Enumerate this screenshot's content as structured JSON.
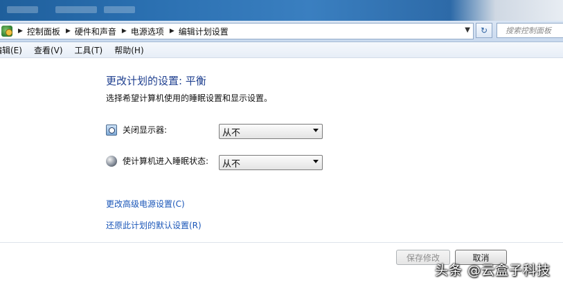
{
  "breadcrumb": [
    "控制面板",
    "硬件和声音",
    "电源选项",
    "编辑计划设置"
  ],
  "search": {
    "placeholder": "搜索控制面板"
  },
  "menu": [
    "编辑(E)",
    "查看(V)",
    "工具(T)",
    "帮助(H)"
  ],
  "page": {
    "title": "更改计划的设置: 平衡",
    "subtitle": "选择希望计算机使用的睡眠设置和显示设置。"
  },
  "settings": [
    {
      "label": "关闭显示器:",
      "value": "从不",
      "icon": "display-timer-icon"
    },
    {
      "label": "使计算机进入睡眠状态:",
      "value": "从不",
      "icon": "sleep-moon-icon"
    }
  ],
  "links": {
    "advanced": "更改高级电源设置(C)",
    "restore": "还原此计划的默认设置(R)"
  },
  "buttons": {
    "save": "保存修改",
    "cancel": "取消"
  },
  "watermark": "头条 @云盒子科技"
}
